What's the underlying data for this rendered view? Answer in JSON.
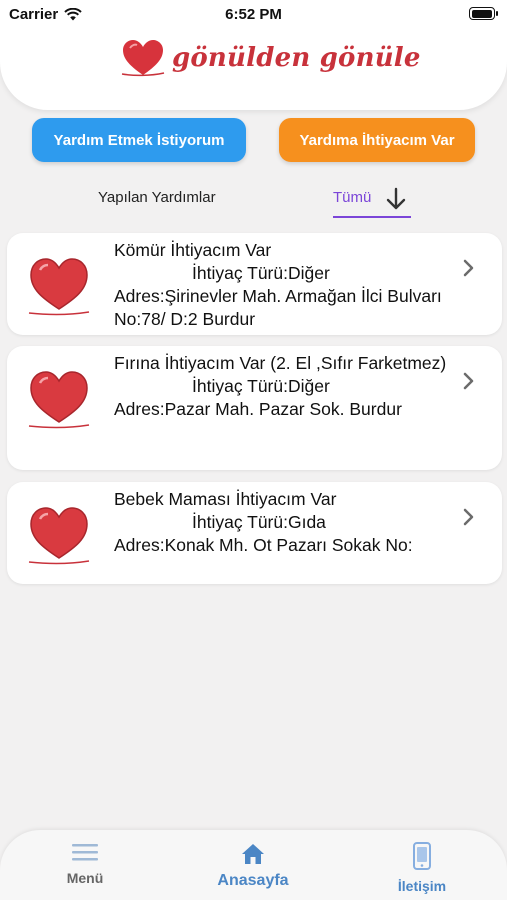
{
  "status_bar": {
    "carrier": "Carrier",
    "time": "6:52 PM",
    "battery_level": 0.95
  },
  "header": {
    "logo_text": "gönülden gönüle",
    "logo_color": "#c8323b"
  },
  "actions": {
    "help_label": "Yardım Etmek İstiyorum",
    "help_color": "#2e9bee",
    "need_label": "Yardıma İhtiyacım Var",
    "need_color": "#f6901e"
  },
  "tabs": {
    "left_label": "Yapılan Yardımlar",
    "right_label": "Tümü",
    "accent": "#7b45d8"
  },
  "cards": [
    {
      "title": "Kömür İhtiyacım Var",
      "type": "İhtiyaç Türü:Diğer",
      "address": "Adres:Şirinevler Mah. Armağan İlci Bulvarı No:78/ D:2 Burdur"
    },
    {
      "title": "Fırına İhtiyacım Var (2. El ,Sıfır Farketmez)",
      "type": "İhtiyaç Türü:Diğer",
      "address": "Adres:Pazar Mah. Pazar Sok. Burdur"
    },
    {
      "title": "Bebek Maması İhtiyacım Var",
      "type": "İhtiyaç Türü:Gıda",
      "address": "Adres:Konak Mh. Ot Pazarı Sokak No:"
    }
  ],
  "tabbar": {
    "menu": "Menü",
    "home": "Anasayfa",
    "contact": "İletişim"
  }
}
